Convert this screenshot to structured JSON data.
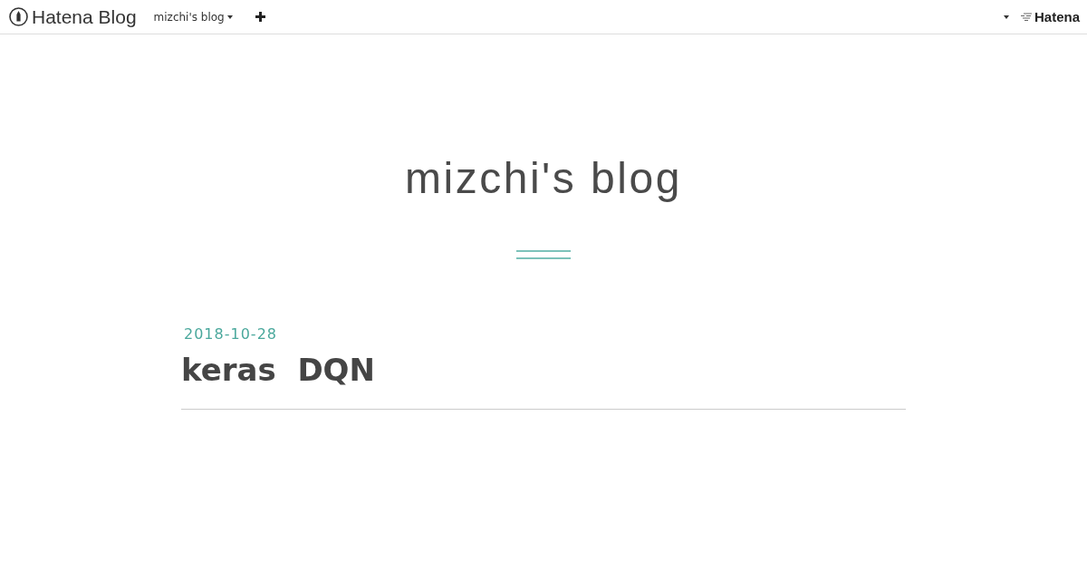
{
  "global_header": {
    "brand": "Hatena Blog",
    "blog_menu": {
      "label": "mizchi's blog"
    },
    "account_menu": {
      "expanded": false
    },
    "hatena_logo": "Hatena"
  },
  "blog_title": "mizchi's blog",
  "entries": [
    {
      "date": "2018-10-28",
      "title": "keras  DQN"
    }
  ]
}
